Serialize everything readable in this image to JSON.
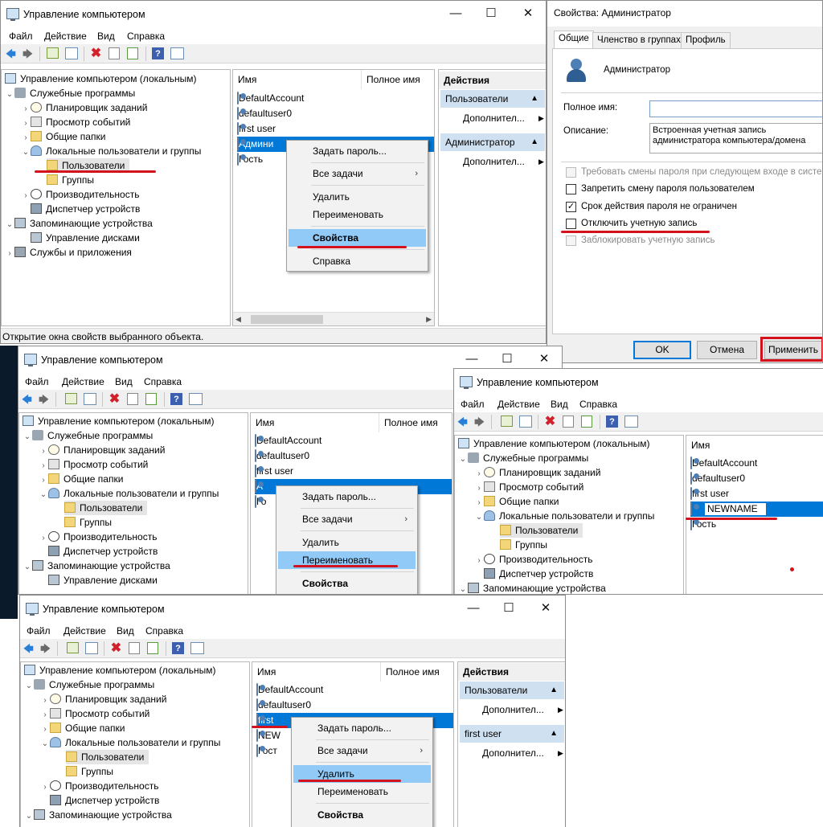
{
  "common": {
    "window_title": "Управление компьютером",
    "menu": [
      "Файл",
      "Действие",
      "Вид",
      "Справка"
    ],
    "col_name": "Имя",
    "col_fullname": "Полное имя",
    "tree": {
      "root": "Управление компьютером (локальным)",
      "tools": "Служебные программы",
      "scheduler": "Планировщик заданий",
      "events": "Просмотр событий",
      "shared": "Общие папки",
      "local_users": "Локальные пользователи и группы",
      "users": "Пользователи",
      "groups": "Группы",
      "perf": "Производительность",
      "devmgr": "Диспетчер устройств",
      "storage": "Запоминающие устройства",
      "diskmgmt": "Управление дисками",
      "services": "Службы и приложения"
    },
    "menu_items": {
      "set_password": "Задать пароль...",
      "all_tasks": "Все задачи",
      "delete": "Удалить",
      "rename": "Переименовать",
      "properties": "Свойства",
      "help": "Справка"
    },
    "actions": {
      "header": "Действия",
      "users": "Пользователи",
      "more": "Дополнител..."
    }
  },
  "win1": {
    "users": [
      "DefaultAccount",
      "defaultuser0",
      "first user",
      "Администратор",
      "Гость"
    ],
    "selected_visible": "Админи",
    "action_selected": "Администратор",
    "status": "Открытие окна свойств выбранного объекта."
  },
  "dialog": {
    "title": "Свойства: Администратор",
    "tabs": [
      "Общие",
      "Членство в группах",
      "Профиль"
    ],
    "user_name": "Администратор",
    "fullname_label": "Полное имя:",
    "fullname_value": "",
    "desc_label": "Описание:",
    "desc_value": "Встроенная учетная запись администратора компьютера/домена",
    "checkboxes": [
      {
        "label": "Требовать смены пароля при следующем входе в систему",
        "checked": false,
        "disabled": true
      },
      {
        "label": "Запретить смену пароля пользователем",
        "checked": false,
        "disabled": false
      },
      {
        "label": "Срок действия пароля не ограничен",
        "checked": true,
        "disabled": false
      },
      {
        "label": "Отключить учетную запись",
        "checked": false,
        "disabled": false
      },
      {
        "label": "Заблокировать учетную запись",
        "checked": false,
        "disabled": true
      }
    ],
    "ok": "OK",
    "cancel": "Отмена",
    "apply": "Применить"
  },
  "win2": {
    "users": [
      "DefaultAccount",
      "defaultuser0",
      "first user",
      "А",
      "Го"
    ]
  },
  "win3": {
    "users": [
      "DefaultAccount",
      "defaultuser0",
      "first user",
      "NEWNAME",
      "Гость"
    ]
  },
  "win4": {
    "users": [
      "DefaultAccount",
      "defaultuser0",
      "first",
      "NEW",
      "Гост"
    ],
    "action_selected": "first user"
  }
}
